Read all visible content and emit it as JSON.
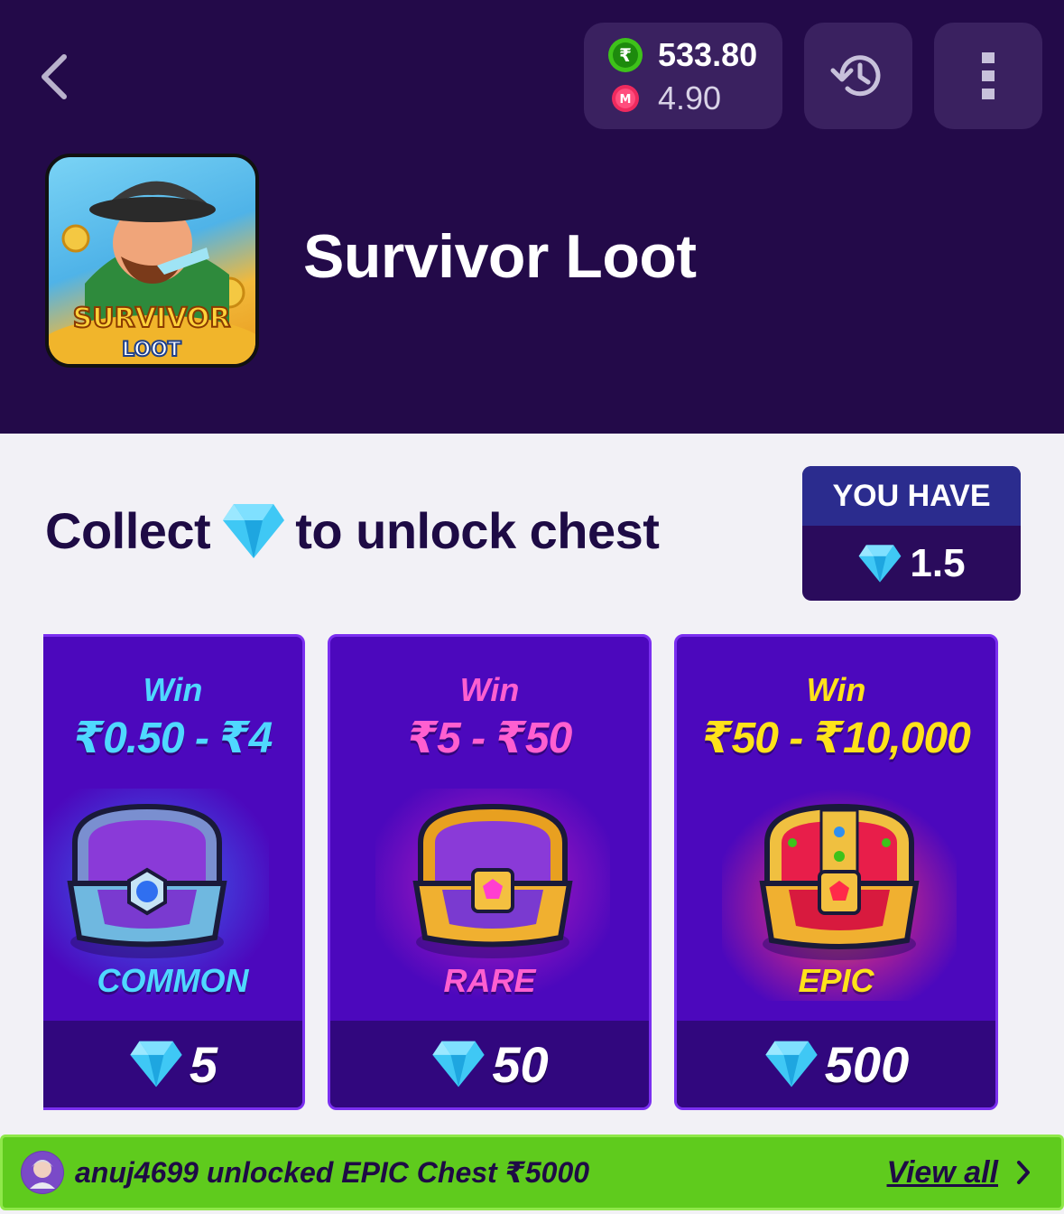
{
  "header": {
    "title": "Survivor Loot",
    "thumbnail_text_top": "SURVIVOR",
    "thumbnail_text_bottom": "LOOT",
    "wallet": {
      "cash": "533.80",
      "cash_icon_glyph": "₹",
      "bonus": "4.90",
      "bonus_icon_glyph": "M"
    }
  },
  "collect": {
    "prefix": "Collect",
    "suffix": "to unlock chest",
    "you_have_label": "YOU HAVE",
    "you_have_value": "1.5"
  },
  "chests": [
    {
      "win_label": "Win",
      "range": "₹0.50 - ₹4",
      "tier": "COMMON",
      "cost": "5",
      "accent": "#4fd8ff"
    },
    {
      "win_label": "Win",
      "range": "₹5 - ₹50",
      "tier": "RARE",
      "cost": "50",
      "accent": "#ff5fd0"
    },
    {
      "win_label": "Win",
      "range": "₹50 - ₹10,000",
      "tier": "EPIC",
      "cost": "500",
      "accent": "#ffe21a"
    }
  ],
  "ticker": {
    "message": "anuj4699 unlocked EPIC Chest ₹5000",
    "view_all": "View all"
  },
  "icons": [
    "back-arrow-icon",
    "rupee-coin-icon",
    "m-coin-icon",
    "history-icon",
    "more-vertical-icon",
    "diamond-icon",
    "chest-icon",
    "chevron-right-icon"
  ]
}
